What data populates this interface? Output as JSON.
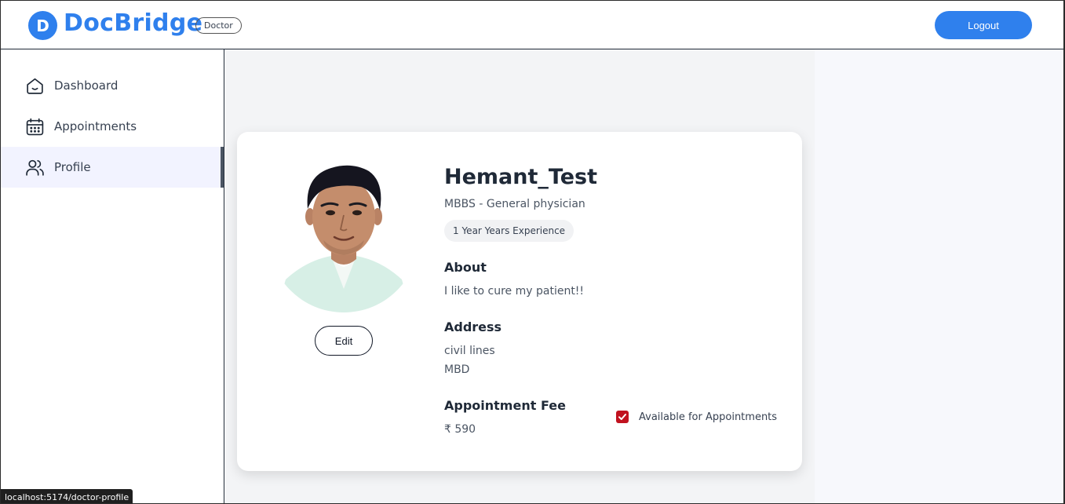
{
  "header": {
    "logo_letter": "D",
    "brand": "DocBridge",
    "role_badge": "Doctor",
    "logout_label": "Logout"
  },
  "sidebar": {
    "items": [
      {
        "label": "Dashboard",
        "icon": "home-icon",
        "active": false
      },
      {
        "label": "Appointments",
        "icon": "calendar-icon",
        "active": false
      },
      {
        "label": "Profile",
        "icon": "people-icon",
        "active": true
      }
    ]
  },
  "profile": {
    "name": "Hemant_Test",
    "degree": "MBBS - General physician",
    "experience": "1 Year Years Experience",
    "about_title": "About",
    "about_text": "I like to cure my patient!!",
    "address_title": "Address",
    "address_line1": "civil lines",
    "address_line2": "MBD",
    "fee_title": "Appointment Fee",
    "fee_value": "₹ 590",
    "edit_label": "Edit",
    "available_label": "Available for Appointments",
    "available": true
  },
  "status_bar": {
    "url": "localhost:5174/doctor-profile"
  },
  "colors": {
    "brand": "#2f80ed",
    "checkbox": "#c1121f",
    "main_bg": "#f3f4f6"
  }
}
